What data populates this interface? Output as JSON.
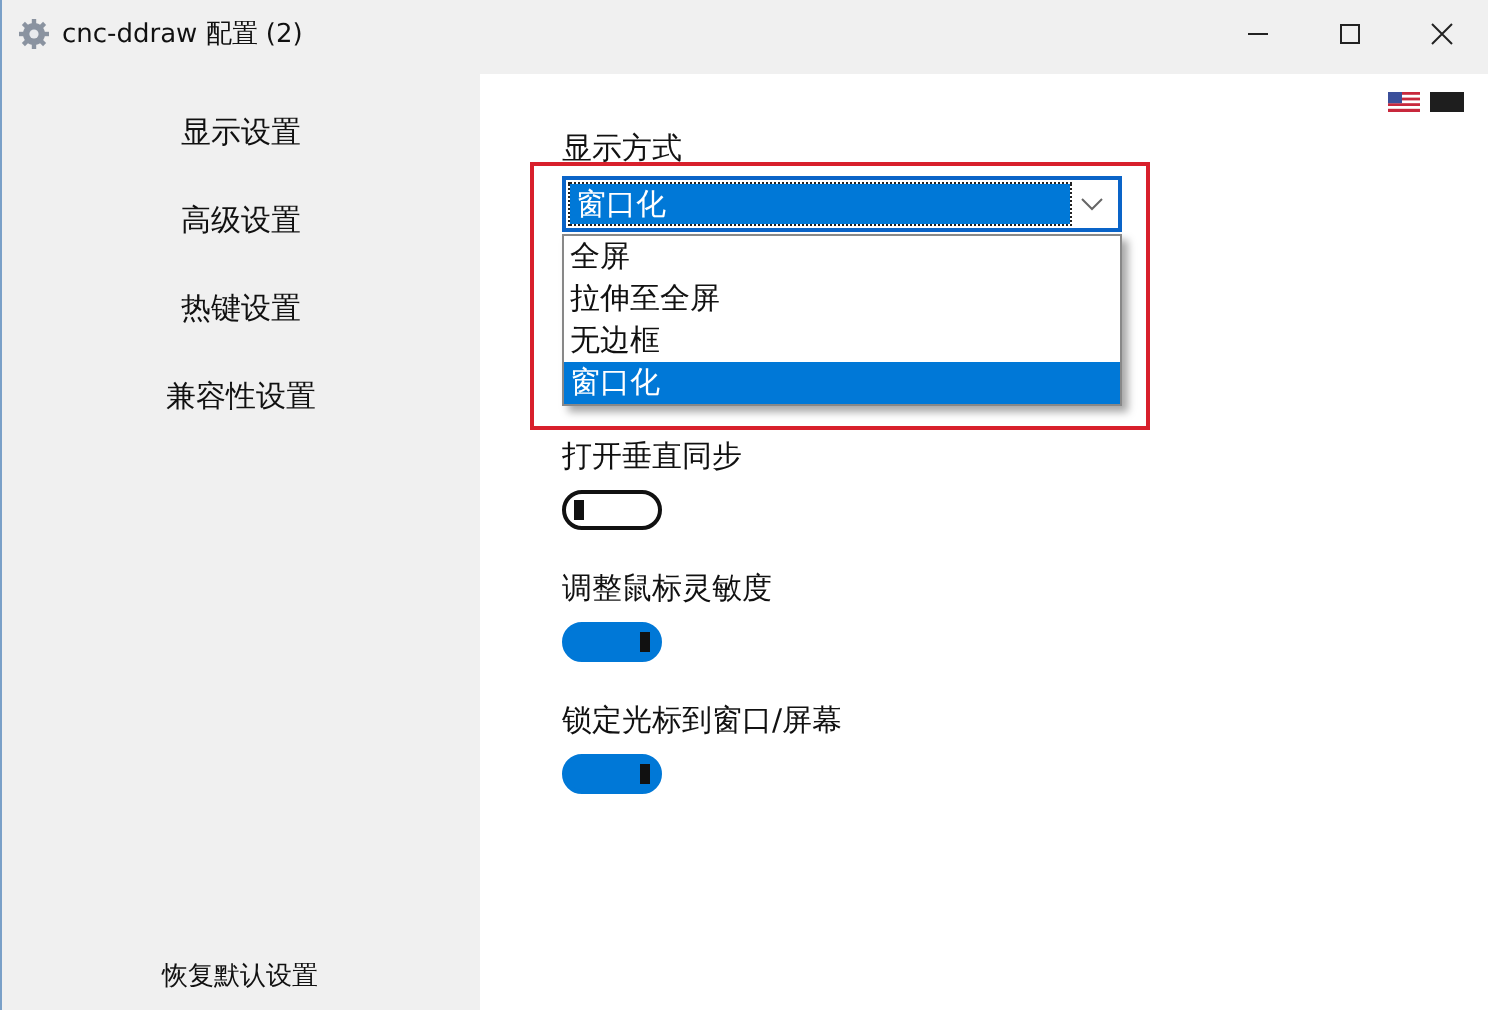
{
  "window": {
    "title": "cnc-ddraw 配置 (2)"
  },
  "sidebar": {
    "items": [
      {
        "label": "显示设置"
      },
      {
        "label": "高级设置"
      },
      {
        "label": "热键设置"
      },
      {
        "label": "兼容性设置"
      }
    ],
    "reset_button": "恢复默认设置"
  },
  "display_mode": {
    "label": "显示方式",
    "value": "窗口化",
    "expanded": true,
    "options": [
      {
        "label": "全屏",
        "selected": false
      },
      {
        "label": "拉伸至全屏",
        "selected": false
      },
      {
        "label": "无边框",
        "selected": false
      },
      {
        "label": "窗口化",
        "selected": true
      }
    ]
  },
  "toggles": [
    {
      "label": "打开垂直同步",
      "on": false
    },
    {
      "label": "调整鼠标灵敏度",
      "on": true
    },
    {
      "label": "锁定光标到窗口/屏幕",
      "on": true
    }
  ]
}
